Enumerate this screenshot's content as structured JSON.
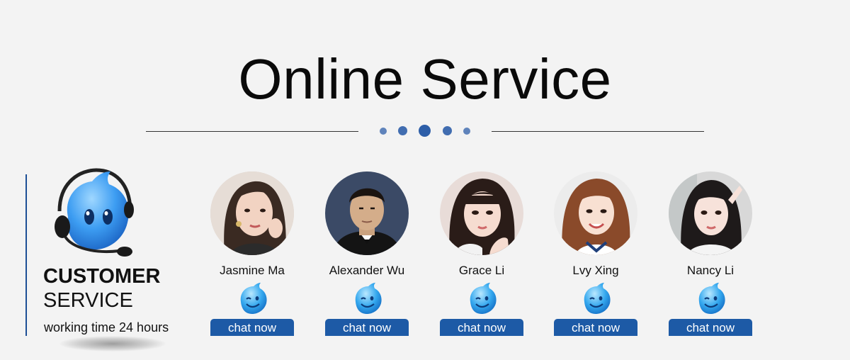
{
  "page": {
    "title": "Online Service"
  },
  "customer_service": {
    "line1": "CUSTOMER",
    "line2": "SERVICE",
    "line3": "working time 24 hours"
  },
  "colors": {
    "accent": "#1d5aa6",
    "dots": "#2d5ea8",
    "background": "#f3f3f3"
  },
  "agents": [
    {
      "name": "Jasmine Ma",
      "button": "chat now",
      "icon": "qq-chat-icon"
    },
    {
      "name": "Alexander Wu",
      "button": "chat now",
      "icon": "qq-chat-icon"
    },
    {
      "name": "Grace Li",
      "button": "chat now",
      "icon": "qq-chat-icon"
    },
    {
      "name": "Lvy Xing",
      "button": "chat now",
      "icon": "qq-chat-icon"
    },
    {
      "name": "Nancy Li",
      "button": "chat now",
      "icon": "qq-chat-icon"
    }
  ]
}
